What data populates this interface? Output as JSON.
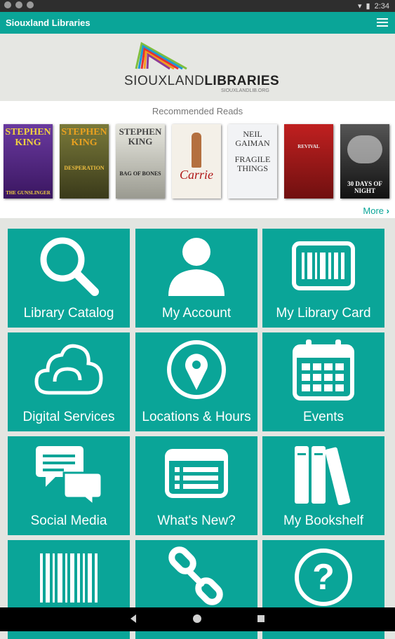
{
  "status_bar": {
    "time": "2:34"
  },
  "app_bar": {
    "title": "Siouxland Libraries"
  },
  "logo": {
    "name_light": "SIOUXLAND",
    "name_bold": "LIBRARIES",
    "url": "SIOUXLANDLIB.ORG"
  },
  "recommended": {
    "title": "Recommended Reads",
    "more_label": "More",
    "books": [
      {
        "author": "STEPHEN KING",
        "title": "THE GUNSLINGER",
        "color": "#5a2a8a"
      },
      {
        "author": "STEPHEN KING",
        "title": "DESPERATION",
        "color": "#5b5a2a"
      },
      {
        "author": "STEPHEN KING",
        "title": "BAG OF BONES",
        "color": "#d9d9d0"
      },
      {
        "author": "",
        "title": "Carrie",
        "color": "#f2eee6"
      },
      {
        "author": "NEIL GAIMAN",
        "title": "FRAGILE THINGS",
        "color": "#eef0f2"
      },
      {
        "author": "",
        "title": "REVIVAL",
        "color": "#a01818"
      },
      {
        "author": "",
        "title": "30 DAYS OF NIGHT",
        "color": "#2a2a2a"
      }
    ]
  },
  "tiles": [
    {
      "label": "Library Catalog",
      "icon": "search-icon"
    },
    {
      "label": "My Account",
      "icon": "person-icon"
    },
    {
      "label": "My Library Card",
      "icon": "barcode-card-icon"
    },
    {
      "label": "Digital Services",
      "icon": "cloud-icon"
    },
    {
      "label": "Locations & Hours",
      "icon": "location-pin-icon"
    },
    {
      "label": "Events",
      "icon": "calendar-icon"
    },
    {
      "label": "Social Media",
      "icon": "chat-bubbles-icon"
    },
    {
      "label": "What's New?",
      "icon": "news-list-icon"
    },
    {
      "label": "My Bookshelf",
      "icon": "books-icon"
    },
    {
      "label": "",
      "icon": "barcode-icon"
    },
    {
      "label": "",
      "icon": "link-icon"
    },
    {
      "label": "",
      "icon": "help-icon"
    }
  ],
  "colors": {
    "accent": "#0aa598",
    "background": "#e3e5e1"
  }
}
